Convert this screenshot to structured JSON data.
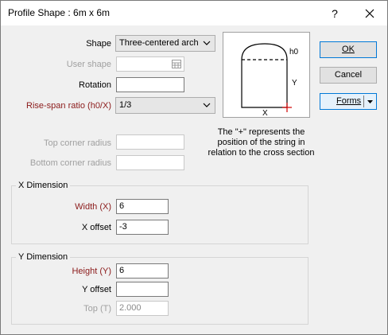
{
  "window": {
    "title": "Profile Shape : 6m x 6m",
    "help_glyph": "?",
    "close_glyph": "✕"
  },
  "form": {
    "shape_label": "Shape",
    "shape_value": "Three-centered arch",
    "user_shape_label": "User shape",
    "user_shape_value": "",
    "rotation_label": "Rotation",
    "rotation_value": "",
    "rise_span_label": "Rise-span ratio (h0/X)",
    "rise_span_value": "1/3",
    "top_corner_label": "Top corner radius",
    "top_corner_value": "",
    "bottom_corner_label": "Bottom corner radius",
    "bottom_corner_value": ""
  },
  "preview": {
    "label_h0": "h0",
    "label_y": "Y",
    "label_x": "X",
    "caption": "The \"+\" represents the position of the string in relation to the cross section"
  },
  "x_dimension": {
    "title": "X Dimension",
    "width_label": "Width (X)",
    "width_value": "6",
    "x_offset_label": "X offset",
    "x_offset_value": "-3"
  },
  "y_dimension": {
    "title": "Y Dimension",
    "height_label": "Height (Y)",
    "height_value": "6",
    "y_offset_label": "Y offset",
    "y_offset_value": "",
    "top_label": "Top (T)",
    "top_value": "2.000"
  },
  "buttons": {
    "ok": "OK",
    "cancel": "Cancel",
    "forms": "Forms"
  },
  "icons": {
    "dropdown": "chevron-down-icon",
    "browse": "grid-icon",
    "help": "help-icon",
    "close": "close-icon"
  },
  "colors": {
    "required_label": "#8b1a1a",
    "default_button_border": "#0078d7",
    "string_marker": "#d00000"
  }
}
